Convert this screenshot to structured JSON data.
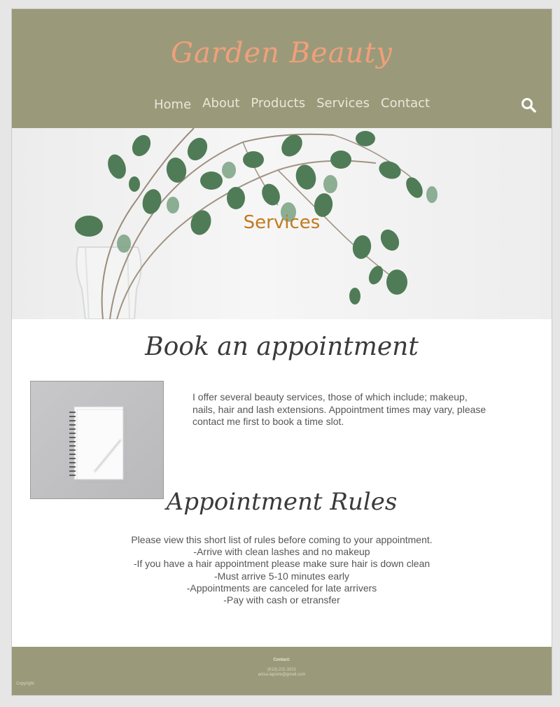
{
  "header": {
    "logo": "Garden Beauty",
    "nav": [
      "Home",
      "About",
      "Products",
      "Services",
      "Contact"
    ]
  },
  "hero": {
    "title": "Services"
  },
  "main": {
    "book_heading": "Book an appointment",
    "intro": "I offer several beauty services, those of which include; makeup, nails, hair and lash extensions. Appointment times may vary, please contact me first to book a time slot.",
    "rules_heading": "Appointment Rules",
    "rules": [
      "Please view this short list of rules before coming to your appointment.",
      "-Arrive with clean lashes and no makeup",
      "-If you have a hair appointment please make sure hair is down clean",
      "-Must arrive 5-10 minutes early",
      "-Appointments are canceled for late arrivers",
      "-Pay with cash or etransfer"
    ]
  },
  "footer": {
    "contact_label": "Contact:",
    "phone": "(613)-211-3101",
    "email": "anisa.laporte@gmail.com",
    "copyright": "Copyright"
  },
  "colors": {
    "header_bg": "#9a9a7a",
    "logo": "#f0a07a",
    "hero_title": "#c27a1e"
  },
  "icons": {
    "search": "search-icon"
  }
}
